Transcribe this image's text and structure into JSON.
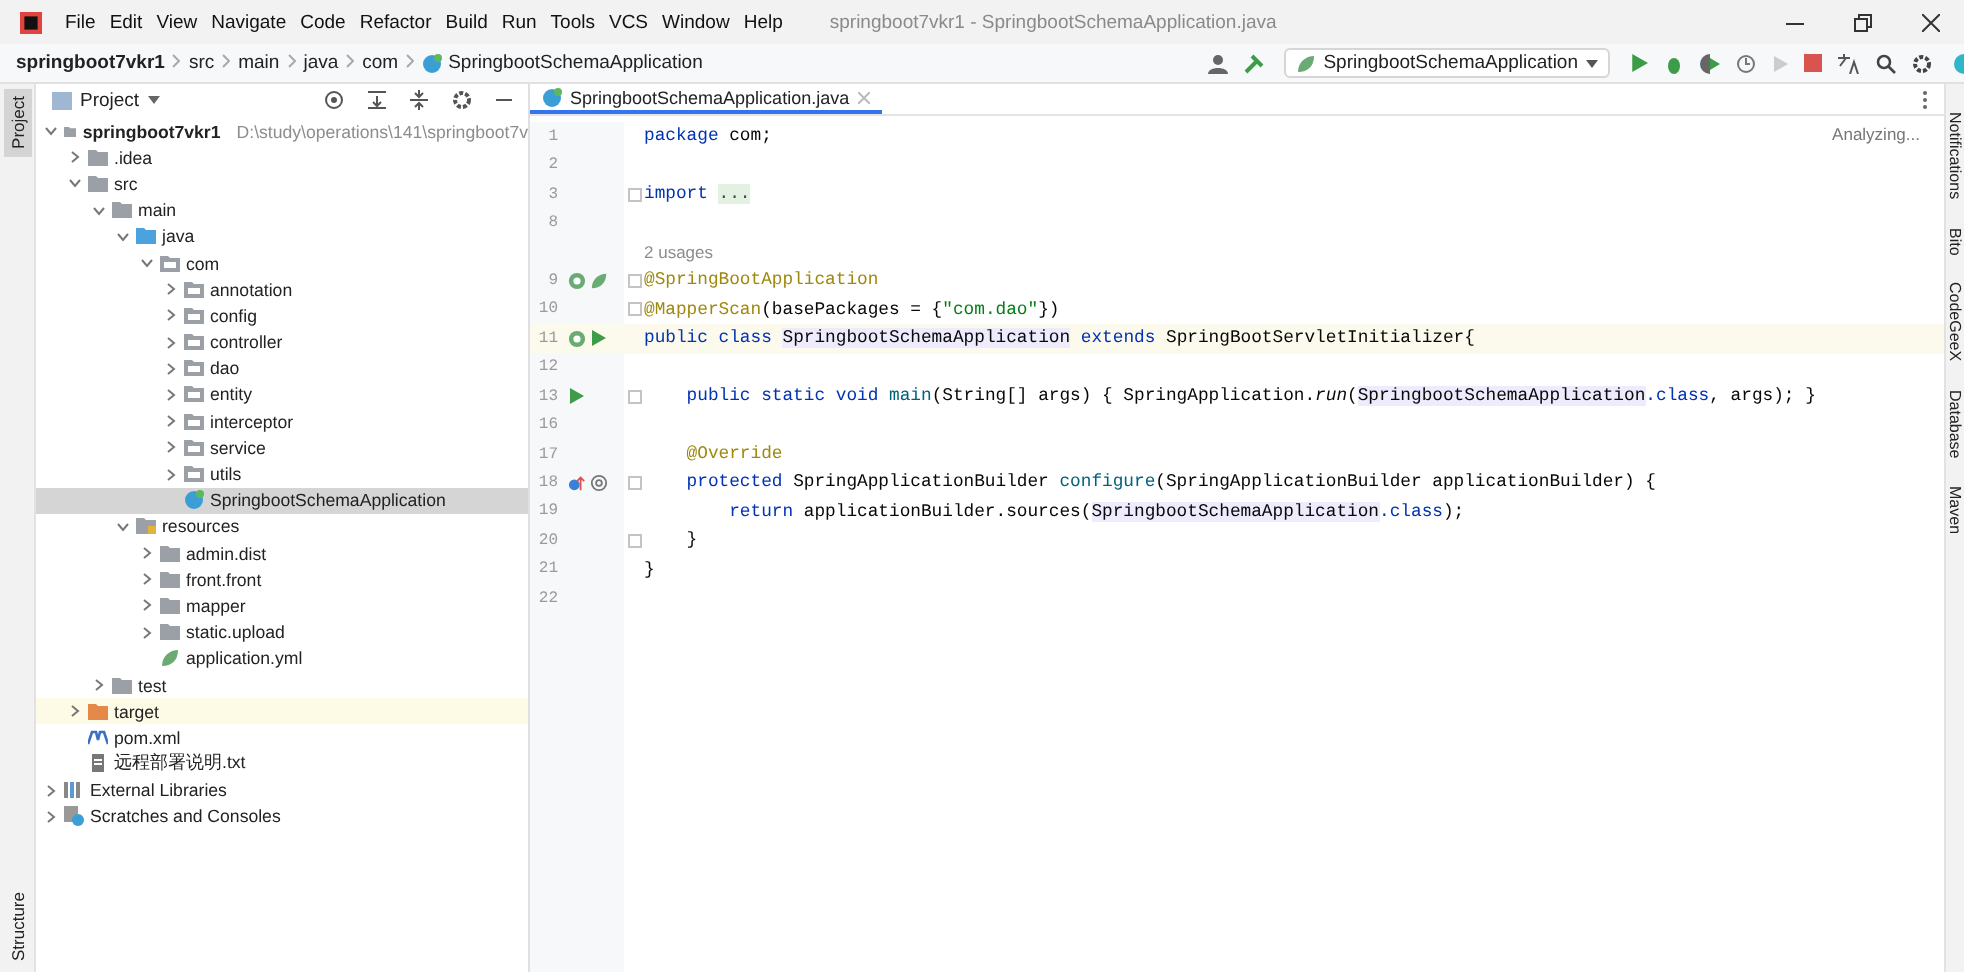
{
  "window": {
    "title": "springboot7vkr1 - SpringbootSchemaApplication.java"
  },
  "menu": [
    "File",
    "Edit",
    "View",
    "Navigate",
    "Code",
    "Refactor",
    "Build",
    "Run",
    "Tools",
    "VCS",
    "Window",
    "Help"
  ],
  "breadcrumbs": [
    "springboot7vkr1",
    "src",
    "main",
    "java",
    "com",
    "SpringbootSchemaApplication"
  ],
  "run_config": "SpringbootSchemaApplication",
  "left_stripe": [
    {
      "label": "Project",
      "selected": true
    },
    {
      "label": "Structure",
      "selected": false
    }
  ],
  "right_stripe": [
    "Notifications",
    "Bito",
    "CodeGeeX",
    "Database",
    "Maven"
  ],
  "project": {
    "title": "Project",
    "tree": [
      {
        "label": "springboot7vkr1",
        "path": "D:\\study\\operations\\141\\springboot7v",
        "kind": "module",
        "expanded": true,
        "selected": false,
        "children": [
          {
            "label": ".idea",
            "kind": "folder",
            "expanded": false,
            "selected": false
          },
          {
            "label": "src",
            "kind": "folder",
            "expanded": true,
            "selected": false,
            "children": [
              {
                "label": "main",
                "kind": "folder",
                "expanded": true,
                "selected": false,
                "children": [
                  {
                    "label": "java",
                    "kind": "source",
                    "expanded": true,
                    "selected": false,
                    "children": [
                      {
                        "label": "com",
                        "kind": "package",
                        "expanded": true,
                        "selected": false,
                        "children": [
                          {
                            "label": "annotation",
                            "kind": "package",
                            "expanded": false,
                            "selected": false
                          },
                          {
                            "label": "config",
                            "kind": "package",
                            "expanded": false,
                            "selected": false
                          },
                          {
                            "label": "controller",
                            "kind": "package",
                            "expanded": false,
                            "selected": false
                          },
                          {
                            "label": "dao",
                            "kind": "package",
                            "expanded": false,
                            "selected": false
                          },
                          {
                            "label": "entity",
                            "kind": "package",
                            "expanded": false,
                            "selected": false
                          },
                          {
                            "label": "interceptor",
                            "kind": "package",
                            "expanded": false,
                            "selected": false
                          },
                          {
                            "label": "service",
                            "kind": "package",
                            "expanded": false,
                            "selected": false
                          },
                          {
                            "label": "utils",
                            "kind": "package",
                            "expanded": false,
                            "selected": false
                          },
                          {
                            "label": "SpringbootSchemaApplication",
                            "kind": "class",
                            "selected": true
                          }
                        ]
                      }
                    ]
                  },
                  {
                    "label": "resources",
                    "kind": "resources",
                    "expanded": true,
                    "selected": false,
                    "children": [
                      {
                        "label": "admin.dist",
                        "kind": "folder",
                        "expanded": false,
                        "selected": false
                      },
                      {
                        "label": "front.front",
                        "kind": "folder",
                        "expanded": false,
                        "selected": false
                      },
                      {
                        "label": "mapper",
                        "kind": "folder",
                        "expanded": false,
                        "selected": false
                      },
                      {
                        "label": "static.upload",
                        "kind": "folder",
                        "expanded": false,
                        "selected": false
                      },
                      {
                        "label": "application.yml",
                        "kind": "yml",
                        "selected": false
                      }
                    ]
                  }
                ]
              },
              {
                "label": "test",
                "kind": "folder",
                "expanded": false,
                "selected": false
              }
            ]
          },
          {
            "label": "target",
            "kind": "excluded",
            "expanded": false,
            "selected": false,
            "highlighted": true
          },
          {
            "label": "pom.xml",
            "kind": "maven",
            "selected": false
          },
          {
            "label": "远程部署说明.txt",
            "kind": "text",
            "selected": false
          }
        ]
      },
      {
        "label": "External Libraries",
        "kind": "libraries",
        "expanded": false,
        "selected": false
      },
      {
        "label": "Scratches and Consoles",
        "kind": "scratches",
        "expanded": false,
        "selected": false
      }
    ]
  },
  "editor": {
    "tab": "SpringbootSchemaApplication.java",
    "status": "Analyzing...",
    "lines": [
      {
        "kind": "code",
        "number": "1",
        "segments": [
          {
            "kind": "kw",
            "text": "package "
          },
          {
            "kind": "plain",
            "text": "com;"
          }
        ]
      },
      {
        "kind": "code",
        "number": "2"
      },
      {
        "kind": "code",
        "number": "3",
        "fold": true,
        "segments": [
          {
            "kind": "kw",
            "text": "import "
          },
          {
            "kind": "folded",
            "text": "..."
          }
        ]
      },
      {
        "kind": "code",
        "number": "8"
      },
      {
        "kind": "hint",
        "text": "2 usages"
      },
      {
        "kind": "code",
        "number": "9",
        "fold": true,
        "markers": [
          {
            "kind": "bean"
          },
          {
            "kind": "spring"
          }
        ],
        "segments": [
          {
            "kind": "ann",
            "text": "@SpringBootApplication"
          }
        ]
      },
      {
        "kind": "code",
        "number": "10",
        "fold": true,
        "segments": [
          {
            "kind": "ann",
            "text": "@MapperScan"
          },
          {
            "kind": "plain",
            "text": "(basePackages = {"
          },
          {
            "kind": "str",
            "text": "\"com.dao\""
          },
          {
            "kind": "plain",
            "text": "})"
          }
        ]
      },
      {
        "kind": "code",
        "number": "11",
        "current": true,
        "markers": [
          {
            "kind": "bean"
          },
          {
            "kind": "run"
          }
        ],
        "segments": [
          {
            "kind": "kw",
            "text": "public class "
          },
          {
            "kind": "ref",
            "text": "SpringbootSchemaApplication"
          },
          {
            "kind": "kw",
            "text": " extends "
          },
          {
            "kind": "plain",
            "text": "SpringBootServletInitializer{"
          }
        ]
      },
      {
        "kind": "code",
        "number": "12"
      },
      {
        "kind": "code",
        "number": "13",
        "fold": true,
        "markers": [
          {
            "kind": "run"
          }
        ],
        "segments": [
          {
            "kind": "kw",
            "text": "    public static void "
          },
          {
            "kind": "method",
            "text": "main"
          },
          {
            "kind": "plain",
            "text": "(String[] args) { SpringApplication."
          },
          {
            "kind": "italic",
            "text": "run"
          },
          {
            "kind": "plain",
            "text": "("
          },
          {
            "kind": "ref",
            "text": "SpringbootSchemaApplication"
          },
          {
            "kind": "kw",
            "text": ".class"
          },
          {
            "kind": "plain",
            "text": ", args); }"
          }
        ]
      },
      {
        "kind": "code",
        "number": "16"
      },
      {
        "kind": "code",
        "number": "17",
        "segments": [
          {
            "kind": "ann",
            "text": "    @Override"
          }
        ]
      },
      {
        "kind": "code",
        "number": "18",
        "fold": true,
        "markers": [
          {
            "kind": "override"
          },
          {
            "kind": "at"
          }
        ],
        "segments": [
          {
            "kind": "kw",
            "text": "    protected "
          },
          {
            "kind": "plain",
            "text": "SpringApplicationBuilder "
          },
          {
            "kind": "method",
            "text": "configure"
          },
          {
            "kind": "plain",
            "text": "(SpringApplicationBuilder applicationBuilder) {"
          }
        ]
      },
      {
        "kind": "code",
        "number": "19",
        "segments": [
          {
            "kind": "kw",
            "text": "        return "
          },
          {
            "kind": "plain",
            "text": "applicationBuilder.sources("
          },
          {
            "kind": "ref",
            "text": "SpringbootSchemaApplication"
          },
          {
            "kind": "kw",
            "text": ".class"
          },
          {
            "kind": "plain",
            "text": ");"
          }
        ]
      },
      {
        "kind": "code",
        "number": "20",
        "fold": true,
        "segments": [
          {
            "kind": "plain",
            "text": "    }"
          }
        ]
      },
      {
        "kind": "code",
        "number": "21",
        "segments": [
          {
            "kind": "plain",
            "text": "}"
          }
        ]
      },
      {
        "kind": "code",
        "number": "22"
      }
    ]
  }
}
